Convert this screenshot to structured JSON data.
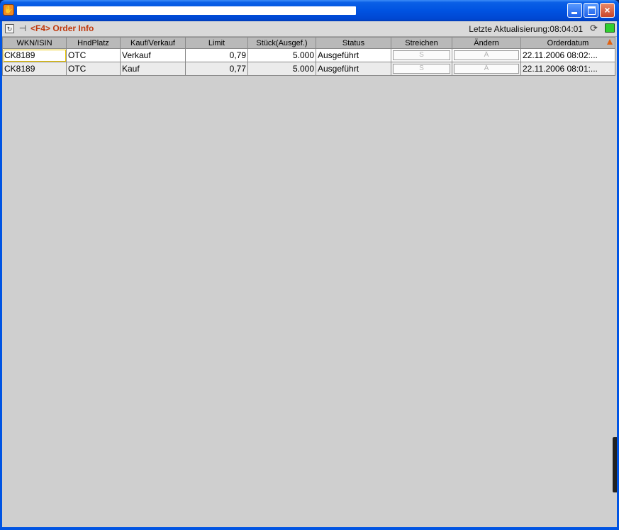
{
  "window": {
    "title": "Order Info",
    "buttons": {
      "minimize": "_",
      "maximize": "□",
      "close": "×"
    }
  },
  "toolbar": {
    "refresh_glyph": "↻",
    "pin_glyph": "⊣",
    "title": "<F4> Order Info",
    "last_update": "Letzte Aktualisierung:08:04:01",
    "reload_glyph": "⟳"
  },
  "colors": {
    "title_accent": "#c0390d",
    "status_led": "#2fcf2f",
    "sort_indicator": "#e06010",
    "selection_outline": "#e8c400"
  },
  "table": {
    "columns": [
      "WKN/ISIN",
      "HndPlatz",
      "Kauf/Verkauf",
      "Limit",
      "Stück(Ausgef.)",
      "Status",
      "Streichen",
      "Ändern",
      "Orderdatum"
    ],
    "sorted_column": "Orderdatum",
    "rows": [
      {
        "wkn": "CK8189",
        "platz": "OTC",
        "kauf_verkauf": "Verkauf",
        "limit": "0,79",
        "stueck": "5.000",
        "status": "Ausgeführt",
        "streichen": "S",
        "aendern": "Ä",
        "orderdatum": "22.11.2006 08:02:..."
      },
      {
        "wkn": "CK8189",
        "platz": "OTC",
        "kauf_verkauf": "Kauf",
        "limit": "0,77",
        "stueck": "5.000",
        "status": "Ausgeführt",
        "streichen": "S",
        "aendern": "Ä",
        "orderdatum": "22.11.2006 08:01:..."
      }
    ]
  }
}
